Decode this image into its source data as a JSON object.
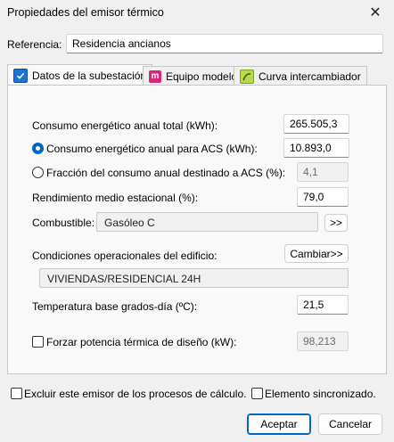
{
  "window": {
    "title": "Propiedades del emisor térmico",
    "close_symbol": "✕"
  },
  "referencia": {
    "label": "Referencia:",
    "value": "Residencia ancianos"
  },
  "tabs": [
    {
      "label": "Datos de la subestación",
      "icon": "checkbox-tab-icon",
      "active": true
    },
    {
      "label": "Equipo modelo",
      "icon": "equipment-icon",
      "active": false
    },
    {
      "label": "Curva intercambiador",
      "icon": "curve-icon",
      "active": false
    }
  ],
  "fields": {
    "consumo_total": {
      "label": "Consumo energético anual total (kWh):",
      "value": "265.505,3"
    },
    "consumo_acs": {
      "label": "Consumo energético anual para ACS (kWh):",
      "value": "10.893,0",
      "selected": true
    },
    "fraccion_acs": {
      "label": "Fracción del consumo anual destinado a ACS (%):",
      "value": "4,1",
      "selected": false
    },
    "rendimiento": {
      "label": "Rendimiento medio estacional (%):",
      "value": "79,0"
    },
    "combustible": {
      "label": "Combustible:",
      "value": "Gasóleo C",
      "button": ">>"
    },
    "condiciones": {
      "label": "Condiciones operacionales del edificio:",
      "button": "Cambiar>>",
      "value": "VIVIENDAS/RESIDENCIAL 24H"
    },
    "temperatura": {
      "label": "Temperatura base grados-día (ºC):",
      "value": "21,5"
    },
    "forzar": {
      "label": "Forzar potencia térmica de diseño (kW):",
      "value": "98,213",
      "checked": false
    }
  },
  "footer": {
    "excluir": {
      "label": "Excluir este emisor de los procesos de cálculo.",
      "checked": false
    },
    "sincronizado": {
      "label": "Elemento sincronizado.",
      "checked": false
    },
    "accept": "Aceptar",
    "cancel": "Cancelar"
  },
  "colors": {
    "accent": "#0067c0",
    "window_bg": "#f0f0f0",
    "panel_bg": "#f9f9f9"
  }
}
